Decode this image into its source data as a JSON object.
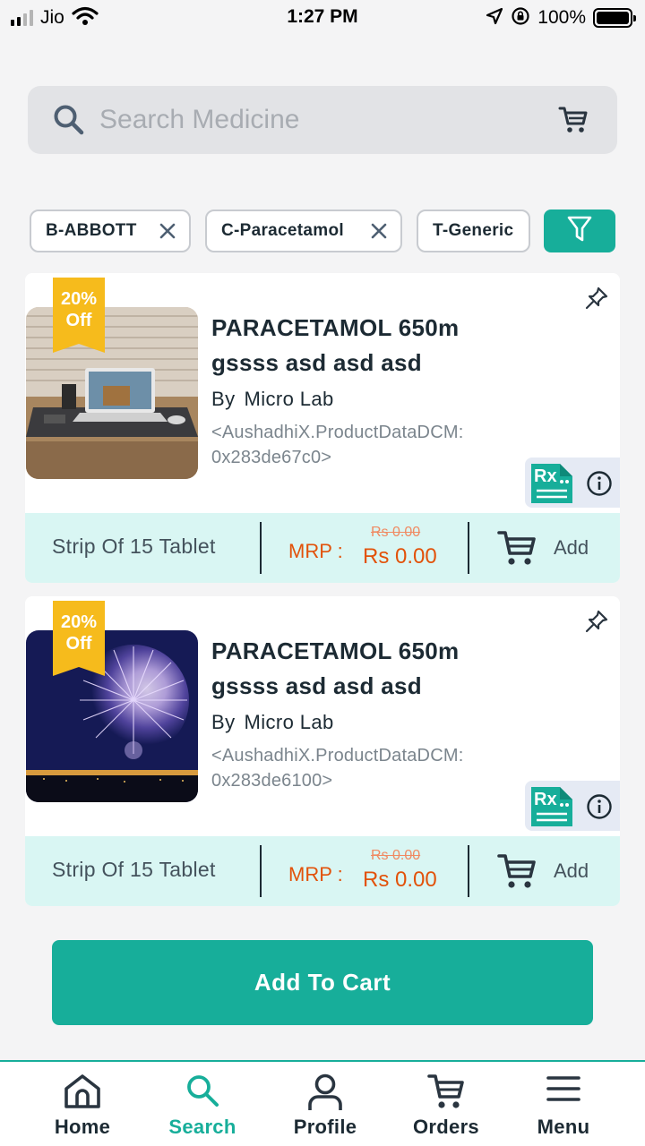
{
  "status_bar": {
    "carrier": "Jio",
    "time": "1:27 PM",
    "battery_percent": "100%",
    "signal_bars": 2
  },
  "search": {
    "placeholder": "Search Medicine",
    "value": ""
  },
  "filters": [
    {
      "label": "B-ABBOTT"
    },
    {
      "label": "C-Paracetamol"
    },
    {
      "label": "T-Generic"
    }
  ],
  "products": [
    {
      "discount_percent": "20%",
      "discount_suffix": "Off",
      "name": "PARACETAMOL 650m gssss asd asd asd",
      "by": "By",
      "manufacturer": "Micro Lab",
      "data_ref": "<AushadhiX.ProductDataDCM: 0x283de67c0>",
      "pack": "Strip Of 15 Tablet",
      "mrp_label": "MRP :",
      "price_old": "Rs 0.00",
      "price_new": "Rs 0.00",
      "add_label": "Add",
      "image_icon": "workspace-photo"
    },
    {
      "discount_percent": "20%",
      "discount_suffix": "Off",
      "name": "PARACETAMOL 650m gssss asd asd asd",
      "by": "By",
      "manufacturer": "Micro Lab",
      "data_ref": "<AushadhiX.ProductDataDCM: 0x283de6100>",
      "pack": "Strip Of 15 Tablet",
      "mrp_label": "MRP :",
      "price_old": "Rs 0.00",
      "price_new": "Rs 0.00",
      "add_label": "Add",
      "image_icon": "fireworks-photo"
    }
  ],
  "add_to_cart_label": "Add To Cart",
  "nav": [
    {
      "label": "Home",
      "icon": "home-icon",
      "active": false
    },
    {
      "label": "Search",
      "icon": "search-icon",
      "active": true
    },
    {
      "label": "Profile",
      "icon": "profile-icon",
      "active": false
    },
    {
      "label": "Orders",
      "icon": "cart-icon",
      "active": false
    },
    {
      "label": "Menu",
      "icon": "menu-icon",
      "active": false
    }
  ],
  "colors": {
    "accent": "#17ae9a",
    "discount_badge": "#f6bb1c",
    "price": "#e2520a",
    "card_footer": "#d9f6f3"
  }
}
